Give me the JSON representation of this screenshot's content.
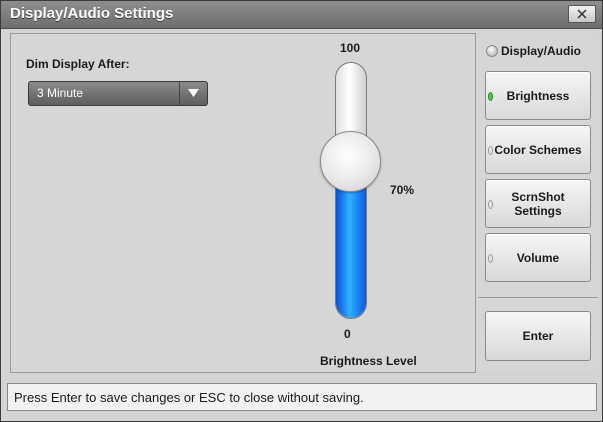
{
  "window": {
    "title": "Display/Audio Settings",
    "close_label": "X"
  },
  "dim_display": {
    "label": "Dim Display After:",
    "selected": "3 Minute"
  },
  "brightness_slider": {
    "max_label": "100",
    "min_label": "0",
    "value_label": "70%",
    "value_fraction": 0.7,
    "caption": "Brightness Level"
  },
  "sidebar": {
    "group_label": "Display/Audio",
    "buttons": [
      {
        "label": "Brightness",
        "active": true
      },
      {
        "label": "Color Schemes",
        "active": false
      },
      {
        "label": "ScrnShot Settings",
        "active": false
      },
      {
        "label": "Volume",
        "active": false
      }
    ],
    "enter_label": "Enter"
  },
  "status": {
    "text": "Press Enter to save changes or ESC to close without saving."
  },
  "colors": {
    "fill_blue": "#1a7ff0",
    "active_indicator": "#40d040"
  }
}
